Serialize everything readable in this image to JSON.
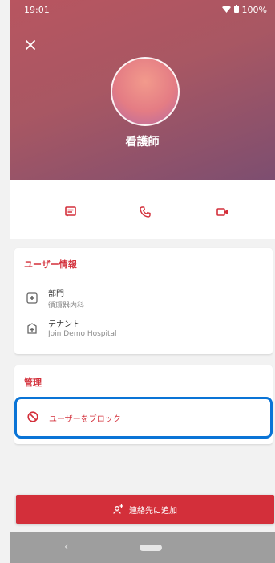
{
  "status_bar": {
    "time": "19:01",
    "battery": "100%"
  },
  "profile": {
    "name": "看護師"
  },
  "actions": {
    "message_icon": "message-icon",
    "call_icon": "phone-icon",
    "video_icon": "video-icon"
  },
  "user_info": {
    "title": "ユーザー情報",
    "department": {
      "label": "部門",
      "value": "循環器内科"
    },
    "tenant": {
      "label": "テナント",
      "value": "Join Demo Hospital"
    }
  },
  "admin": {
    "title": "管理",
    "block_user": "ユーザーをブロック"
  },
  "footer": {
    "add_contact": "連絡先に追加"
  },
  "colors": {
    "accent": "#d32f3a",
    "highlight": "#0a74d6"
  }
}
